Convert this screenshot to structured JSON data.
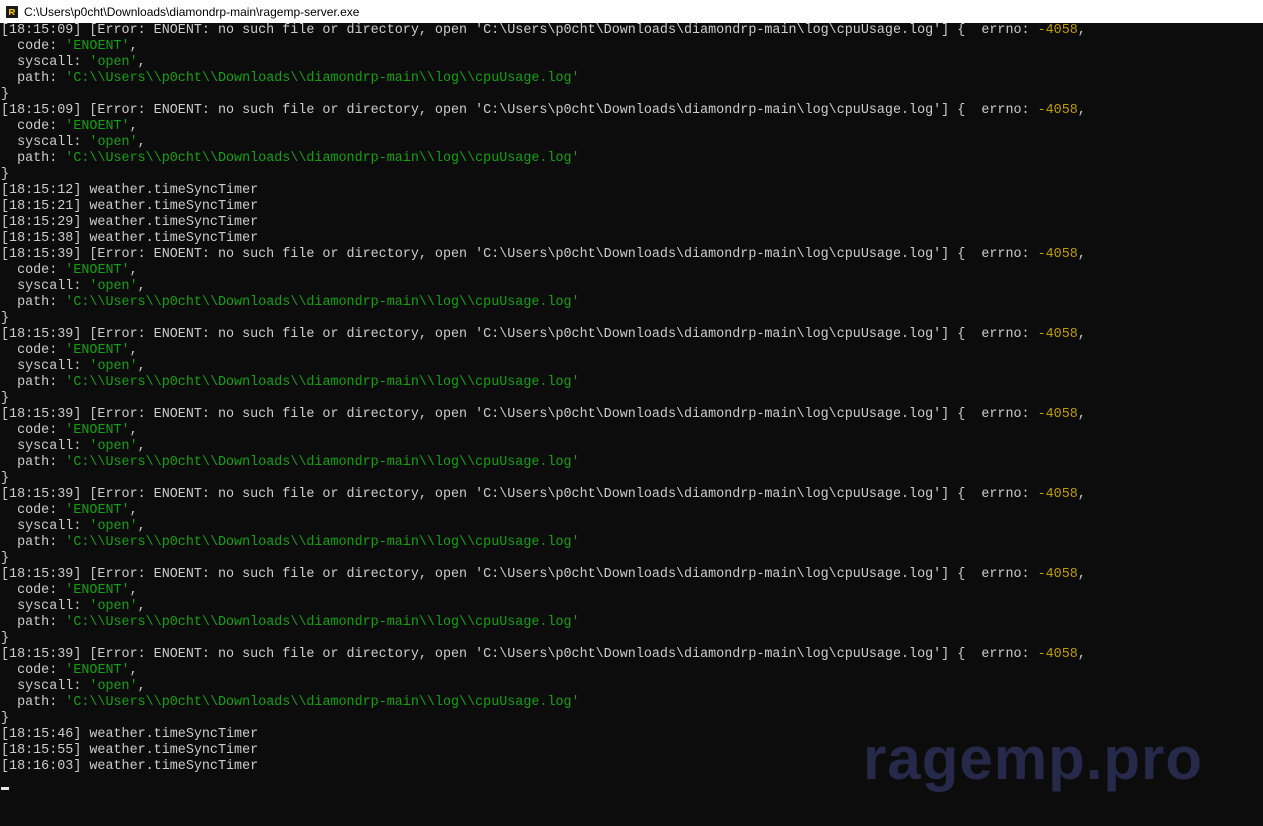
{
  "window": {
    "title": "C:\\Users\\p0cht\\Downloads\\diamondrp-main\\ragemp-server.exe"
  },
  "console": {
    "colors": {
      "background": "#0c0c0c",
      "text": "#cccccc",
      "string": "#13a10e",
      "number": "#c19c00"
    },
    "lines": [
      [
        {
          "t": "[18:15:09] [Error: ENOENT: no such file or directory, open 'C:\\Users\\p0cht\\Downloads\\diamondrp-main\\log\\cpuUsage.log'] {  errno: "
        },
        {
          "t": "-4058",
          "c": "num"
        },
        {
          "t": ","
        }
      ],
      [
        {
          "t": "  code: "
        },
        {
          "t": "'ENOENT'",
          "c": "str"
        },
        {
          "t": ","
        }
      ],
      [
        {
          "t": "  syscall: "
        },
        {
          "t": "'open'",
          "c": "str"
        },
        {
          "t": ","
        }
      ],
      [
        {
          "t": "  path: "
        },
        {
          "t": "'C:\\\\Users\\\\p0cht\\\\Downloads\\\\diamondrp-main\\\\log\\\\cpuUsage.log'",
          "c": "str"
        }
      ],
      [
        {
          "t": "}"
        }
      ],
      [
        {
          "t": "[18:15:09] [Error: ENOENT: no such file or directory, open 'C:\\Users\\p0cht\\Downloads\\diamondrp-main\\log\\cpuUsage.log'] {  errno: "
        },
        {
          "t": "-4058",
          "c": "num"
        },
        {
          "t": ","
        }
      ],
      [
        {
          "t": "  code: "
        },
        {
          "t": "'ENOENT'",
          "c": "str"
        },
        {
          "t": ","
        }
      ],
      [
        {
          "t": "  syscall: "
        },
        {
          "t": "'open'",
          "c": "str"
        },
        {
          "t": ","
        }
      ],
      [
        {
          "t": "  path: "
        },
        {
          "t": "'C:\\\\Users\\\\p0cht\\\\Downloads\\\\diamondrp-main\\\\log\\\\cpuUsage.log'",
          "c": "str"
        }
      ],
      [
        {
          "t": "}"
        }
      ],
      [
        {
          "t": "[18:15:12] weather.timeSyncTimer"
        }
      ],
      [
        {
          "t": "[18:15:21] weather.timeSyncTimer"
        }
      ],
      [
        {
          "t": "[18:15:29] weather.timeSyncTimer"
        }
      ],
      [
        {
          "t": "[18:15:38] weather.timeSyncTimer"
        }
      ],
      [
        {
          "t": "[18:15:39] [Error: ENOENT: no such file or directory, open 'C:\\Users\\p0cht\\Downloads\\diamondrp-main\\log\\cpuUsage.log'] {  errno: "
        },
        {
          "t": "-4058",
          "c": "num"
        },
        {
          "t": ","
        }
      ],
      [
        {
          "t": "  code: "
        },
        {
          "t": "'ENOENT'",
          "c": "str"
        },
        {
          "t": ","
        }
      ],
      [
        {
          "t": "  syscall: "
        },
        {
          "t": "'open'",
          "c": "str"
        },
        {
          "t": ","
        }
      ],
      [
        {
          "t": "  path: "
        },
        {
          "t": "'C:\\\\Users\\\\p0cht\\\\Downloads\\\\diamondrp-main\\\\log\\\\cpuUsage.log'",
          "c": "str"
        }
      ],
      [
        {
          "t": "}"
        }
      ],
      [
        {
          "t": "[18:15:39] [Error: ENOENT: no such file or directory, open 'C:\\Users\\p0cht\\Downloads\\diamondrp-main\\log\\cpuUsage.log'] {  errno: "
        },
        {
          "t": "-4058",
          "c": "num"
        },
        {
          "t": ","
        }
      ],
      [
        {
          "t": "  code: "
        },
        {
          "t": "'ENOENT'",
          "c": "str"
        },
        {
          "t": ","
        }
      ],
      [
        {
          "t": "  syscall: "
        },
        {
          "t": "'open'",
          "c": "str"
        },
        {
          "t": ","
        }
      ],
      [
        {
          "t": "  path: "
        },
        {
          "t": "'C:\\\\Users\\\\p0cht\\\\Downloads\\\\diamondrp-main\\\\log\\\\cpuUsage.log'",
          "c": "str"
        }
      ],
      [
        {
          "t": "}"
        }
      ],
      [
        {
          "t": "[18:15:39] [Error: ENOENT: no such file or directory, open 'C:\\Users\\p0cht\\Downloads\\diamondrp-main\\log\\cpuUsage.log'] {  errno: "
        },
        {
          "t": "-4058",
          "c": "num"
        },
        {
          "t": ","
        }
      ],
      [
        {
          "t": "  code: "
        },
        {
          "t": "'ENOENT'",
          "c": "str"
        },
        {
          "t": ","
        }
      ],
      [
        {
          "t": "  syscall: "
        },
        {
          "t": "'open'",
          "c": "str"
        },
        {
          "t": ","
        }
      ],
      [
        {
          "t": "  path: "
        },
        {
          "t": "'C:\\\\Users\\\\p0cht\\\\Downloads\\\\diamondrp-main\\\\log\\\\cpuUsage.log'",
          "c": "str"
        }
      ],
      [
        {
          "t": "}"
        }
      ],
      [
        {
          "t": "[18:15:39] [Error: ENOENT: no such file or directory, open 'C:\\Users\\p0cht\\Downloads\\diamondrp-main\\log\\cpuUsage.log'] {  errno: "
        },
        {
          "t": "-4058",
          "c": "num"
        },
        {
          "t": ","
        }
      ],
      [
        {
          "t": "  code: "
        },
        {
          "t": "'ENOENT'",
          "c": "str"
        },
        {
          "t": ","
        }
      ],
      [
        {
          "t": "  syscall: "
        },
        {
          "t": "'open'",
          "c": "str"
        },
        {
          "t": ","
        }
      ],
      [
        {
          "t": "  path: "
        },
        {
          "t": "'C:\\\\Users\\\\p0cht\\\\Downloads\\\\diamondrp-main\\\\log\\\\cpuUsage.log'",
          "c": "str"
        }
      ],
      [
        {
          "t": "}"
        }
      ],
      [
        {
          "t": "[18:15:39] [Error: ENOENT: no such file or directory, open 'C:\\Users\\p0cht\\Downloads\\diamondrp-main\\log\\cpuUsage.log'] {  errno: "
        },
        {
          "t": "-4058",
          "c": "num"
        },
        {
          "t": ","
        }
      ],
      [
        {
          "t": "  code: "
        },
        {
          "t": "'ENOENT'",
          "c": "str"
        },
        {
          "t": ","
        }
      ],
      [
        {
          "t": "  syscall: "
        },
        {
          "t": "'open'",
          "c": "str"
        },
        {
          "t": ","
        }
      ],
      [
        {
          "t": "  path: "
        },
        {
          "t": "'C:\\\\Users\\\\p0cht\\\\Downloads\\\\diamondrp-main\\\\log\\\\cpuUsage.log'",
          "c": "str"
        }
      ],
      [
        {
          "t": "}"
        }
      ],
      [
        {
          "t": "[18:15:39] [Error: ENOENT: no such file or directory, open 'C:\\Users\\p0cht\\Downloads\\diamondrp-main\\log\\cpuUsage.log'] {  errno: "
        },
        {
          "t": "-4058",
          "c": "num"
        },
        {
          "t": ","
        }
      ],
      [
        {
          "t": "  code: "
        },
        {
          "t": "'ENOENT'",
          "c": "str"
        },
        {
          "t": ","
        }
      ],
      [
        {
          "t": "  syscall: "
        },
        {
          "t": "'open'",
          "c": "str"
        },
        {
          "t": ","
        }
      ],
      [
        {
          "t": "  path: "
        },
        {
          "t": "'C:\\\\Users\\\\p0cht\\\\Downloads\\\\diamondrp-main\\\\log\\\\cpuUsage.log'",
          "c": "str"
        }
      ],
      [
        {
          "t": "}"
        }
      ],
      [
        {
          "t": "[18:15:46] weather.timeSyncTimer"
        }
      ],
      [
        {
          "t": "[18:15:55] weather.timeSyncTimer"
        }
      ],
      [
        {
          "t": "[18:16:03] weather.timeSyncTimer"
        }
      ]
    ]
  },
  "watermark": {
    "text": "ragemp.pro",
    "color": "#27294a"
  }
}
